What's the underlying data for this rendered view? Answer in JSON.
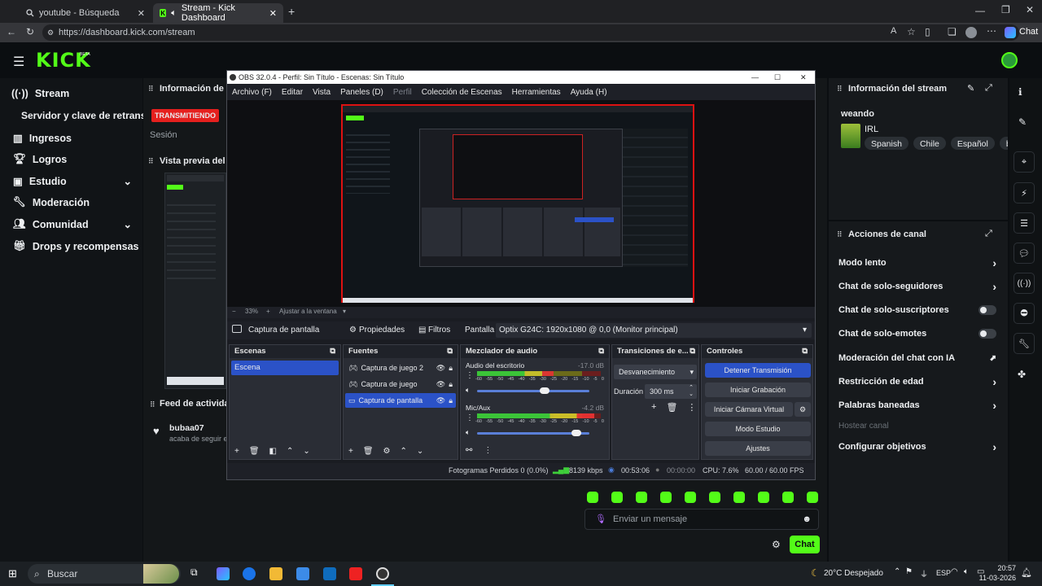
{
  "browser": {
    "tabs": [
      {
        "title": "youtube - Búsqueda"
      },
      {
        "title": "Stream - Kick Dashboard"
      }
    ],
    "url": "https://dashboard.kick.com/stream",
    "chat_label": "Chat"
  },
  "kick": {
    "logo": "KICK",
    "logo_sup": "BETA",
    "nav": [
      {
        "label": "Stream",
        "icon": "stream-icon"
      },
      {
        "label": "Servidor y clave de retransm"
      },
      {
        "label": "Ingresos",
        "icon": "income-icon"
      },
      {
        "label": "Logros",
        "icon": "trophy-icon"
      },
      {
        "label": "Estudio",
        "icon": "studio-icon"
      },
      {
        "label": "Moderación",
        "icon": "wrench-icon"
      },
      {
        "label": "Comunidad",
        "icon": "people-icon"
      },
      {
        "label": "Drops y recompensas",
        "icon": "gift-icon"
      }
    ],
    "center": {
      "info_title": "Información de la",
      "live_badge": "TRANSMITIENDO",
      "session_label": "Sesión",
      "preview_title": "Vista previa del st",
      "feed_title": "Feed de actividad",
      "feed_user": "bubaa07",
      "feed_text": "acaba de seguir el"
    },
    "right": {
      "info_title": "Información del stream",
      "stream_title": "weando",
      "category": "IRL",
      "tags": [
        "Spanish",
        "Chile",
        "Español",
        "byk"
      ],
      "actions_title": "Acciones de canal",
      "actions": [
        {
          "label": "Modo lento",
          "type": "arrow"
        },
        {
          "label": "Chat de solo-seguidores",
          "type": "arrow"
        },
        {
          "label": "Chat de solo-suscriptores",
          "type": "toggle"
        },
        {
          "label": "Chat de solo-emotes",
          "type": "toggle"
        },
        {
          "label": "Moderación del chat con IA",
          "type": "external"
        },
        {
          "label": "Restricción de edad",
          "type": "arrow"
        },
        {
          "label": "Palabras baneadas",
          "type": "arrow"
        },
        {
          "label": "Hostear canal",
          "type": "disabled"
        },
        {
          "label": "Configurar objetivos",
          "type": "arrow"
        }
      ]
    },
    "chat": {
      "placeholder": "Enviar un mensaje",
      "send_label": "Chat"
    }
  },
  "obs": {
    "title": "OBS 32.0.4 - Perfil: Sin Título - Escenas: Sin Título",
    "menu": [
      "Archivo (F)",
      "Editar",
      "Vista",
      "Paneles (D)",
      "Perfil",
      "Colección de Escenas",
      "Herramientas",
      "Ayuda (H)"
    ],
    "zoom": "33%",
    "fit_label": "Ajustar a la ventana",
    "source_name": "Captura de pantalla",
    "properties": "Propiedades",
    "filters": "Filtros",
    "screen_label": "Pantalla",
    "screen_value": "Optix G24C: 1920x1080 @ 0,0 (Monitor principal)",
    "scenes_title": "Escenas",
    "scenes": [
      "Escena"
    ],
    "sources_title": "Fuentes",
    "sources": [
      "Captura de juego 2",
      "Captura de juego",
      "Captura de pantalla"
    ],
    "mixer_title": "Mezclador de audio",
    "mixer": [
      {
        "name": "Audio del escritorio",
        "db": "-17.0 dB",
        "level": 0.62
      },
      {
        "name": "Mic/Aux",
        "db": "-4.2 dB",
        "level": 0.95
      }
    ],
    "meter_ticks": [
      "-60",
      "-55",
      "-50",
      "-45",
      "-40",
      "-35",
      "-30",
      "-25",
      "-20",
      "-15",
      "-10",
      "-5",
      "0"
    ],
    "transitions_title": "Transiciones de e...",
    "transition": "Desvanecimiento",
    "duration_label": "Duración",
    "duration_value": "300 ms",
    "controls_title": "Controles",
    "controls": [
      "Detener Transmisión",
      "Iniciar Grabación",
      "Iniciar Cámara Virtual",
      "Modo Estudio",
      "Ajustes"
    ],
    "status": {
      "dropped": "Fotogramas Perdidos 0 (0.0%)",
      "bitrate": "8139 kbps",
      "live_time": "00:53:06",
      "rec_time": "00:00:00",
      "cpu": "CPU: 7.6%",
      "fps": "60.00 / 60.00 FPS"
    }
  },
  "taskbar": {
    "search": "Buscar",
    "weather": "20°C  Despejado",
    "lang": "ESP",
    "time": "20:57",
    "date": "11-03-2026"
  },
  "colors": {
    "kick_green": "#53fc18",
    "live_red": "#e5201e",
    "obs_blue": "#2b52c7"
  }
}
